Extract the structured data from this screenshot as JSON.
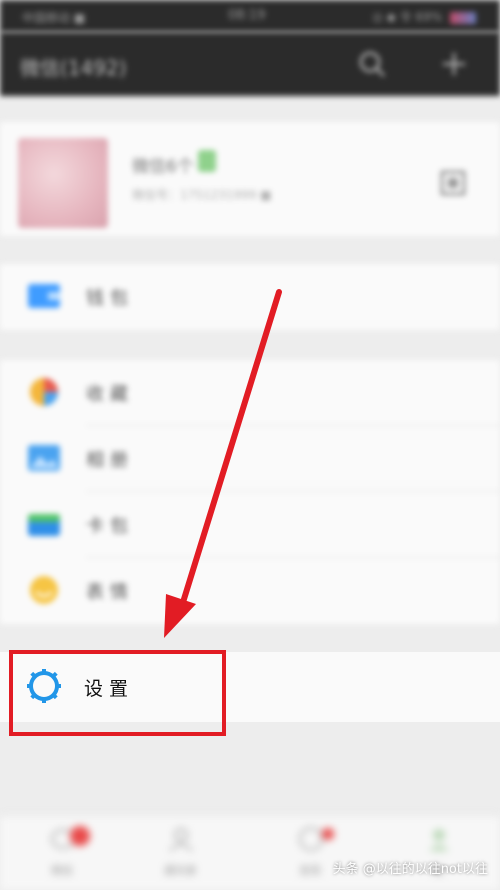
{
  "status_bar": {
    "carrier": "中国移动 ■",
    "time": "08:19",
    "signal": "◎ ◆ 令 69%"
  },
  "nav": {
    "title": "微信(1492)"
  },
  "profile": {
    "name": "微信6个",
    "subtitle": "微信号：1751231999 ■"
  },
  "group_wallet": [
    {
      "label": "钱包",
      "icon": "wallet-icon",
      "color": "#3f9cff"
    }
  ],
  "group_main": [
    {
      "label": "收藏",
      "icon": "favorites-icon",
      "color": "#e85b4f"
    },
    {
      "label": "相册",
      "icon": "album-icon",
      "color": "#4aa3f0"
    },
    {
      "label": "卡包",
      "icon": "card-icon",
      "color": "#2f8fe8"
    },
    {
      "label": "表情",
      "icon": "emoji-icon",
      "color": "#f6c544"
    }
  ],
  "settings": {
    "label": "设置",
    "icon": "gear-icon",
    "color": "#2196e8"
  },
  "tabs": [
    {
      "label": "微信",
      "icon": "chat-icon"
    },
    {
      "label": "通讯录",
      "icon": "contacts-icon"
    },
    {
      "label": "发现",
      "icon": "discover-icon"
    },
    {
      "label": "我",
      "icon": "me-icon"
    }
  ],
  "annotation": {
    "arrow_color": "#e21c24",
    "box_color": "#e21c24"
  },
  "watermark": "头条 @以往的以往not以往"
}
